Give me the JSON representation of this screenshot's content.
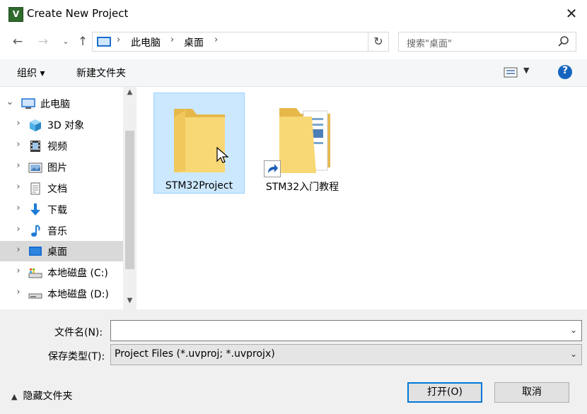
{
  "window": {
    "title": "Create New Project",
    "app_icon_letter": "V"
  },
  "nav": {
    "breadcrumb": [
      "此电脑",
      "桌面"
    ],
    "search_placeholder": "搜索\"桌面\""
  },
  "toolbar": {
    "organize_label": "组织 ▾",
    "new_folder_label": "新建文件夹",
    "help_label": "?"
  },
  "tree": {
    "items": [
      {
        "label": "此电脑",
        "icon": "computer-icon",
        "expanded": true
      },
      {
        "label": "3D 对象",
        "icon": "3d-objects-icon"
      },
      {
        "label": "视频",
        "icon": "video-icon"
      },
      {
        "label": "图片",
        "icon": "pictures-icon"
      },
      {
        "label": "文档",
        "icon": "documents-icon"
      },
      {
        "label": "下载",
        "icon": "download-icon"
      },
      {
        "label": "音乐",
        "icon": "music-icon"
      },
      {
        "label": "桌面",
        "icon": "desktop-icon",
        "selected": true
      },
      {
        "label": "本地磁盘 (C:)",
        "icon": "drive-c-icon"
      },
      {
        "label": "本地磁盘 (D:)",
        "icon": "drive-d-icon"
      }
    ]
  },
  "content": {
    "items": [
      {
        "name": "STM32Project",
        "type": "folder",
        "selected": true
      },
      {
        "name": "STM32入门教程",
        "type": "folder-shortcut"
      }
    ]
  },
  "form": {
    "filename_label": "文件名(N):",
    "filename_value": "",
    "filetype_label": "保存类型(T):",
    "filetype_value": "Project Files (*.uvproj; *.uvprojx)"
  },
  "footer": {
    "hide_folders_label": "隐藏文件夹",
    "open_label": "打开(O)",
    "cancel_label": "取消"
  },
  "colors": {
    "accent": "#0078d7",
    "selection": "#cce8ff",
    "folder": "#f8d775"
  }
}
